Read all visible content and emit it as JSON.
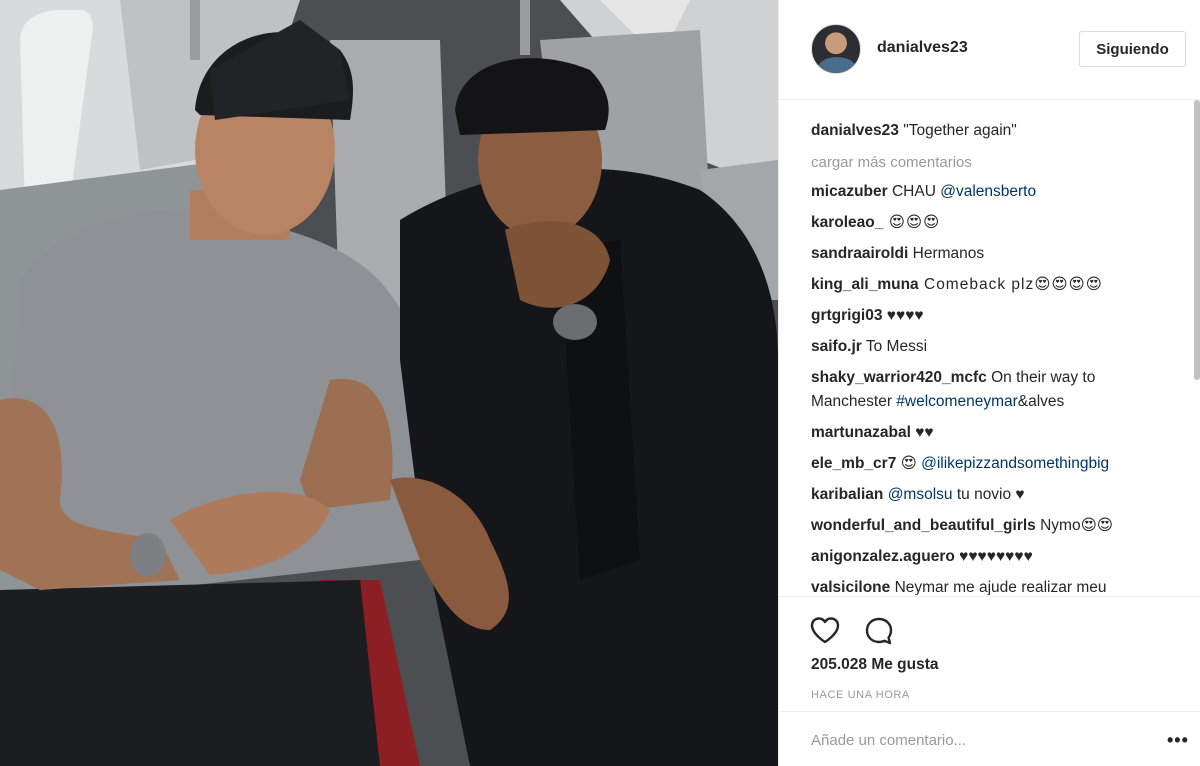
{
  "post": {
    "username": "danialves23",
    "follow_label": "Siguiendo",
    "caption_user": "danialves23",
    "caption_text": " \"Together again\"",
    "load_more": "cargar más comentarios",
    "likes": "205.028 Me gusta",
    "timestamp": "HACE UNA HORA",
    "comment_placeholder": "Añade un comentario...",
    "more_label": "•••"
  },
  "comments": [
    {
      "user": "micazuber",
      "text": " CHAU ",
      "mention": "@valensberto",
      "after": ""
    },
    {
      "user": "karoleao_",
      "text": " 😍😍😍",
      "mention": "",
      "after": ""
    },
    {
      "user": "sandraairoldi",
      "text": " Hermanos",
      "mention": "",
      "after": ""
    },
    {
      "user": "king_ali_muna",
      "text": " Comeback plz😍😍😍😍",
      "mention": "",
      "after": ""
    },
    {
      "user": "grtgrigi03",
      "text": " ♥♥♥♥",
      "mention": "",
      "after": ""
    },
    {
      "user": "saifo.jr",
      "text": " To Messi",
      "mention": "",
      "after": ""
    },
    {
      "user": "shaky_warrior420_mcfc",
      "text": " On their way to Manchester ",
      "mention": "#welcomeneymar",
      "after": "&alves"
    },
    {
      "user": "martunazabal",
      "text": " ♥♥",
      "mention": "",
      "after": ""
    },
    {
      "user": "ele_mb_cr7",
      "text": " 😍 ",
      "mention": "@ilikepizzandsomethingbig",
      "after": ""
    },
    {
      "user": "karibalian",
      "text": " ",
      "mention": "@msolsu",
      "after": " tu novio ♥"
    },
    {
      "user": "wonderful_and_beautiful_girls",
      "text": " Nymo😍😍",
      "mention": "",
      "after": ""
    },
    {
      "user": "anigonzalez.aguero",
      "text": " ♥♥♥♥♥♥♥♥",
      "mention": "",
      "after": ""
    },
    {
      "user": "valsicilone",
      "text": " Neymar me ajude realizar meu",
      "mention": "",
      "after": ""
    }
  ]
}
